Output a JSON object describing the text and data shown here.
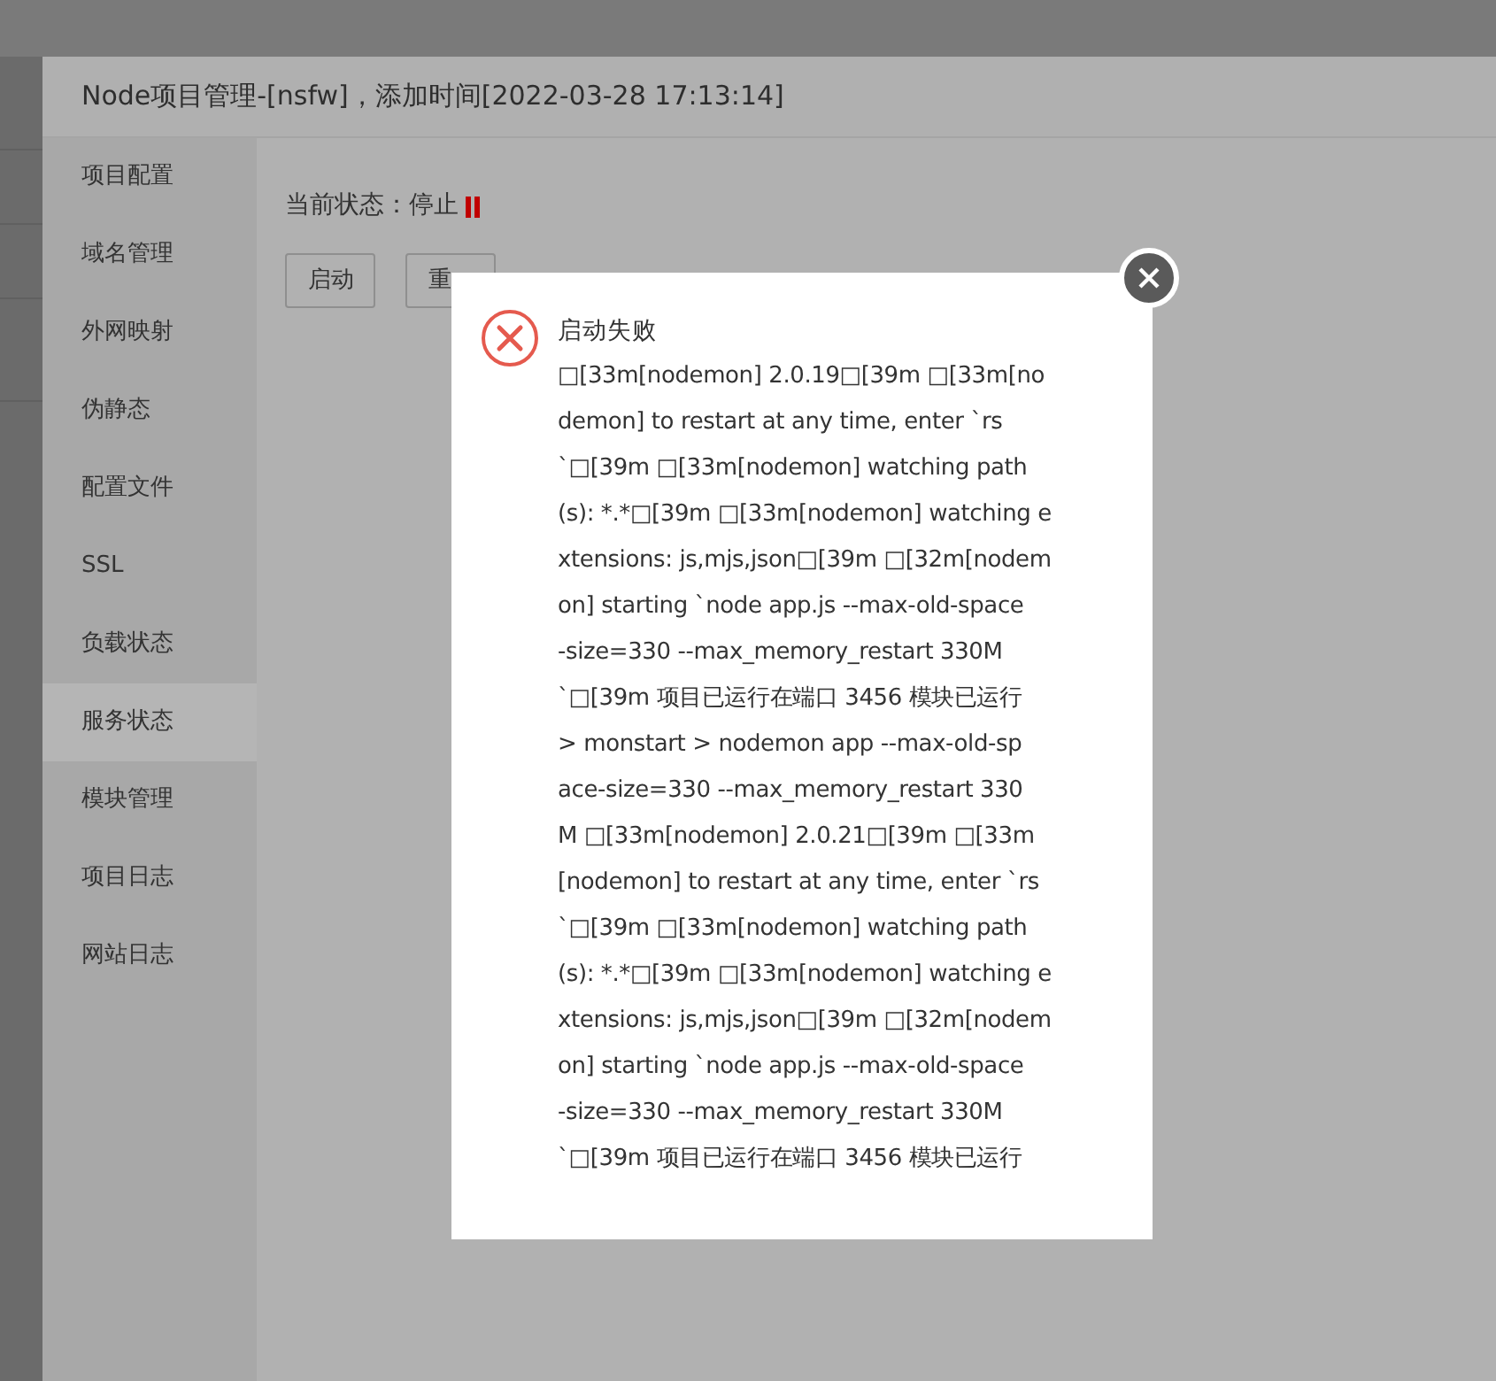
{
  "window": {
    "title": "Node项目管理-[nsfw]，添加时间[2022-03-28 17:13:14]"
  },
  "sidebar": {
    "items": [
      {
        "label": "项目配置",
        "selected": false
      },
      {
        "label": "域名管理",
        "selected": false
      },
      {
        "label": "外网映射",
        "selected": false
      },
      {
        "label": "伪静态",
        "selected": false
      },
      {
        "label": "配置文件",
        "selected": false
      },
      {
        "label": "SSL",
        "selected": false
      },
      {
        "label": "负载状态",
        "selected": false
      },
      {
        "label": "服务状态",
        "selected": true
      },
      {
        "label": "模块管理",
        "selected": false
      },
      {
        "label": "项目日志",
        "selected": false
      },
      {
        "label": "网站日志",
        "selected": false
      }
    ]
  },
  "status": {
    "label": "当前状态：",
    "value": "停止",
    "running": false
  },
  "buttons": [
    "启动",
    "重"
  ],
  "dialog": {
    "kind": "error",
    "title": "启动失败",
    "lines": [
      "□[33m[nodemon] 2.0.19□[39m □[33m[no",
      "demon] to restart at any time, enter `rs",
      "`□[39m □[33m[nodemon] watching path",
      "(s): *.*□[39m □[33m[nodemon] watching e",
      "xtensions: js,mjs,json□[39m □[32m[nodem",
      "on] starting `node app.js --max-old-space",
      "-size=330 --max_memory_restart 330M",
      "`□[39m 项目已运行在端口 3456 模块已运行",
      "> monstart > nodemon app --max-old-sp",
      "ace-size=330 --max_memory_restart 330",
      "M □[33m[nodemon] 2.0.21□[39m □[33m",
      "[nodemon] to restart at any time, enter `rs",
      "`□[39m □[33m[nodemon] watching path",
      "(s): *.*□[39m □[33m[nodemon] watching e",
      "xtensions: js,mjs,json□[39m □[32m[nodem",
      "on] starting `node app.js --max-old-space",
      "-size=330 --max_memory_restart 330M",
      "`□[39m 项目已运行在端口 3456 模块已运行"
    ]
  }
}
